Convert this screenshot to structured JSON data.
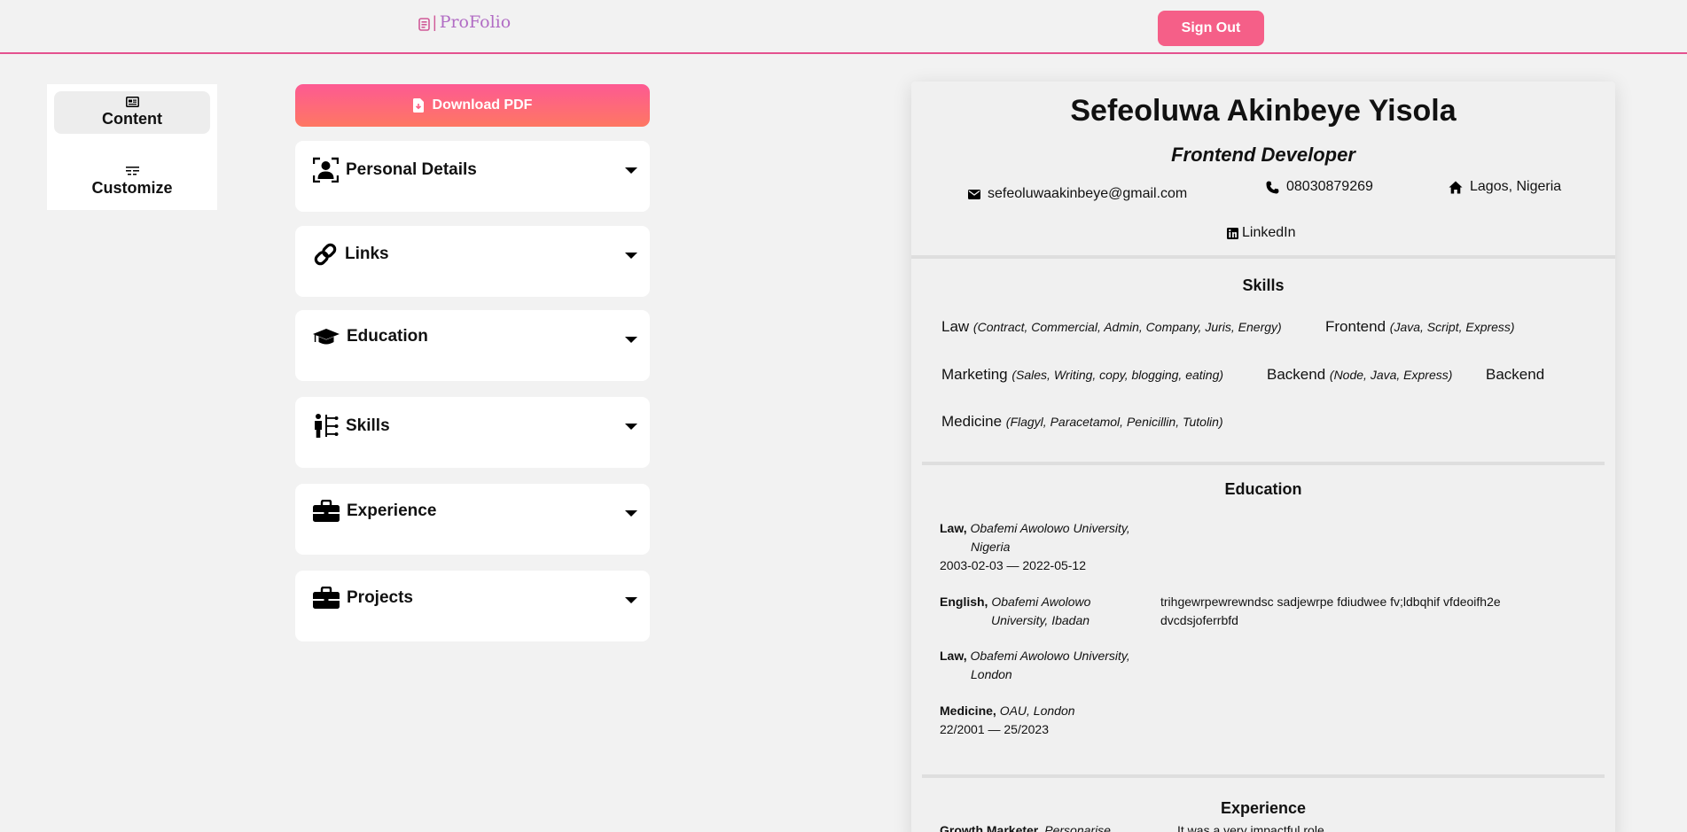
{
  "header": {
    "logo_text": "ProFolio",
    "signout_label": "Sign Out"
  },
  "colors": {
    "accent": "#f55f88",
    "gradient_start": "#fd5a93",
    "gradient_end": "#fe7763",
    "logo": "#b16cc4"
  },
  "side_tabs": [
    {
      "label": "Content",
      "icon": "content-icon",
      "active": true
    },
    {
      "label": "Customize",
      "icon": "customize-icon",
      "active": false
    }
  ],
  "editor": {
    "download_label": "Download PDF",
    "sections": [
      {
        "label": "Personal Details",
        "icon": "person-icon"
      },
      {
        "label": "Links",
        "icon": "link-icon"
      },
      {
        "label": "Education",
        "icon": "graduation-cap-icon"
      },
      {
        "label": "Skills",
        "icon": "skills-icon"
      },
      {
        "label": "Experience",
        "icon": "briefcase-icon"
      },
      {
        "label": "Projects",
        "icon": "briefcase-icon"
      }
    ]
  },
  "resume": {
    "name": "Sefeoluwa Akinbeye Yisola",
    "role": "Frontend Developer",
    "email": "sefeoluwaakinbeye@gmail.com",
    "phone": "08030879269",
    "location": "Lagos, Nigeria",
    "link": "LinkedIn",
    "skills_heading": "Skills",
    "skills": [
      {
        "name": "Law",
        "detail": "(Contract, Commercial, Admin, Company, Juris, Energy)"
      },
      {
        "name": "Frontend",
        "detail": "(Java, Script, Express)"
      },
      {
        "name": "Marketing",
        "detail": "(Sales, Writing, copy, blogging, eating)"
      },
      {
        "name": "Backend",
        "detail": "(Node, Java, Express)"
      },
      {
        "name": "Backend",
        "detail": ""
      },
      {
        "name": "Medicine",
        "detail": "(Flagyl, Paracetamol, Penicillin, Tutolin)"
      }
    ],
    "education_heading": "Education",
    "education": [
      {
        "degree": "Law,",
        "institution_l1": "Obafemi Awolowo University,",
        "institution_l2": "Nigeria",
        "dates": "2003-02-03 — 2022-05-12",
        "description": ""
      },
      {
        "degree": "English,",
        "institution_l1": "Obafemi Awolowo",
        "institution_l2": "University, Ibadan",
        "dates": "",
        "description": "trihgewrpewrewndsc sadjewrpe fdiudwee fv;ldbqhif vfdeoifh2e dvcdsjoferrbfd"
      },
      {
        "degree": "Law,",
        "institution_l1": "Obafemi Awolowo University,",
        "institution_l2": "London",
        "dates": "",
        "description": ""
      },
      {
        "degree": "Medicine,",
        "institution_l1": "OAU, London",
        "institution_l2": "",
        "dates": "22/2001 — 25/2023",
        "description": ""
      }
    ],
    "experience_heading": "Experience",
    "experience": [
      {
        "title": "Growth Marketer,",
        "company": "Personarise",
        "description": "It was a very impactful role"
      }
    ]
  }
}
